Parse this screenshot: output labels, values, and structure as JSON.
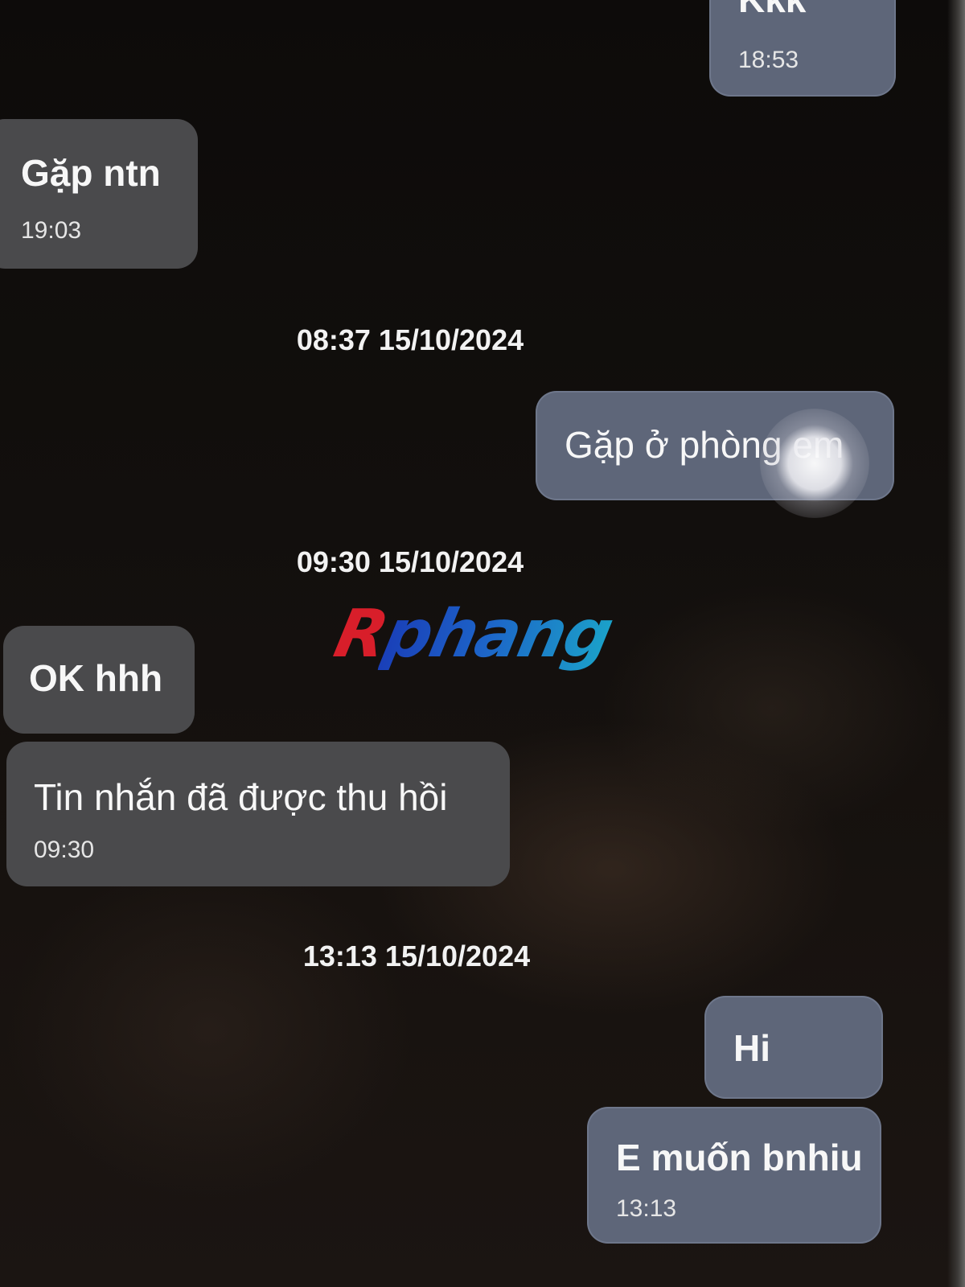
{
  "messages": [
    {
      "direction": "outgoing",
      "text": "Kkk",
      "time": "18:53"
    },
    {
      "direction": "incoming",
      "text": "Gặp ntn",
      "time": "19:03"
    },
    {
      "direction": "outgoing",
      "text": "Gặp ở phòng em"
    },
    {
      "direction": "incoming",
      "text": "OK hhh"
    },
    {
      "direction": "incoming",
      "text": "Tin nhắn đã được thu hồi",
      "time": "09:30",
      "recalled": true
    },
    {
      "direction": "outgoing",
      "text": "Hi"
    },
    {
      "direction": "outgoing",
      "text": "E muốn bnhiu",
      "time": "13:13"
    }
  ],
  "separators": [
    "08:37 15/10/2024",
    "09:30 15/10/2024",
    "13:13 15/10/2024"
  ],
  "watermark": {
    "first_letter": "R",
    "rest": "phang",
    "colors": {
      "first": "#d81e2a",
      "rest_start": "#1a3fb8",
      "rest_end": "#1ba2c9"
    }
  },
  "colors": {
    "outgoing_bubble": "#5e6679",
    "incoming_bubble": "#4a4a4c",
    "background": "#120f0d"
  }
}
